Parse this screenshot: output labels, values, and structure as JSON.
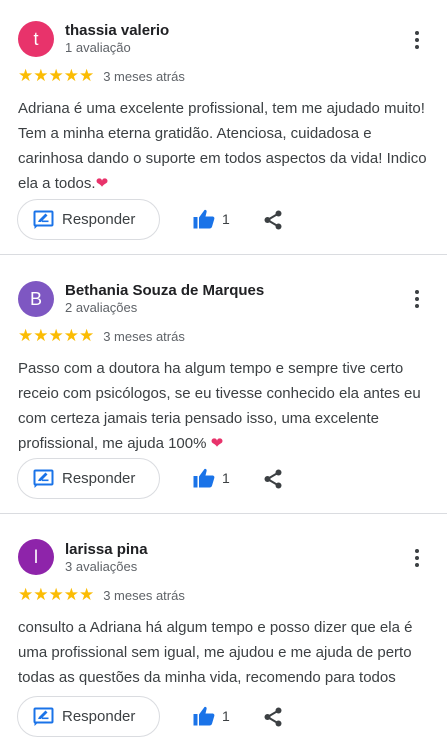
{
  "reviews": [
    {
      "avatar_letter": "t",
      "avatar_color": "#e8336b",
      "name": "thassia valerio",
      "count": "1 avaliação",
      "stars": "★★★★★",
      "date": "3 meses atrás",
      "text": "Adriana é uma excelente profissional, tem me ajudado muito! Tem a minha eterna gratidão. Atenciosa, cuidadosa e carinhosa dando o suporte em todos aspectos da vida! Indico ela a todos.",
      "emoji": "❤",
      "reply_label": "Responder",
      "likes": "1"
    },
    {
      "avatar_letter": "B",
      "avatar_color": "#7e57c2",
      "name": "Bethania Souza de Marques",
      "count": "2 avaliações",
      "stars": "★★★★★",
      "date": "3 meses atrás",
      "text": "Passo com a doutora ha algum tempo e sempre tive certo receio com psicólogos, se eu tivesse conhecido ela antes eu com certeza jamais teria pensado isso, uma excelente profissional, me ajuda 100% ",
      "emoji": "❤",
      "reply_label": "Responder",
      "likes": "1"
    },
    {
      "avatar_letter": "l",
      "avatar_color": "#8e24aa",
      "name": "larissa pina",
      "count": "3 avaliações",
      "stars": "★★★★★",
      "date": "3 meses atrás",
      "text": "consulto a Adriana há algum tempo e posso dizer que ela é uma profissional sem igual, me ajudou e me ajuda de perto todas as questões da minha vida, recomendo para todos",
      "emoji": "",
      "reply_label": "Responder",
      "likes": "1"
    }
  ]
}
